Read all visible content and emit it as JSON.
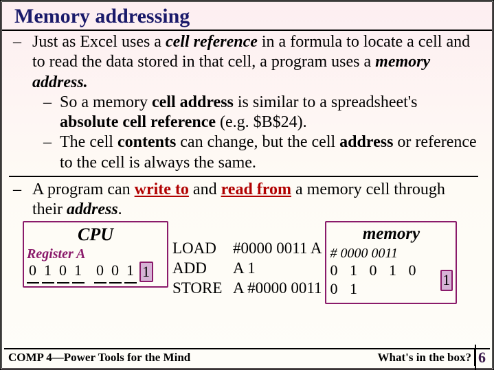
{
  "title": "Memory addressing",
  "p1": {
    "t1": "Just as Excel uses a ",
    "b1": "cell reference",
    "t2": " in a formula to locate a cell and to read the data stored in that cell, a program uses a ",
    "b2": "memory address.",
    "sub1": {
      "t1": "So a memory ",
      "b1": "cell address",
      "t2": " is similar to a spreadsheet's ",
      "b2": "absolute cell reference",
      "t3": "  (e.g. $B$24)."
    },
    "sub2": {
      "t1": "The cell ",
      "b1": "contents",
      "t2": " can change, but the cell ",
      "b2": "address",
      "t3": " or reference to the cell is always the same."
    }
  },
  "p2": {
    "t1": "A program can ",
    "r1": "write to",
    "t2": " and ",
    "r2": "read from",
    "t3": " a memory cell through their ",
    "b1": "address",
    "t4": "."
  },
  "cpu": {
    "title": "CPU",
    "reg_label": "Register A",
    "bits": [
      "0",
      "1",
      "0",
      "1",
      "0",
      "0",
      "1",
      "1"
    ]
  },
  "instr": {
    "r1": {
      "op": "LOAD",
      "args": "#0000 0011   A"
    },
    "r2": {
      "op": "ADD",
      "args": "A   1"
    },
    "r3": {
      "op": "STORE",
      "args": "A   #0000 0011"
    }
  },
  "mem": {
    "title": "memory",
    "addr": "# 0000 0011",
    "bits_group": "0 1 0 1  0 0 1",
    "bits_last": "1"
  },
  "footer": {
    "left": "COMP 4—Power Tools for the Mind",
    "right": "What's in the box?",
    "page": "6"
  }
}
